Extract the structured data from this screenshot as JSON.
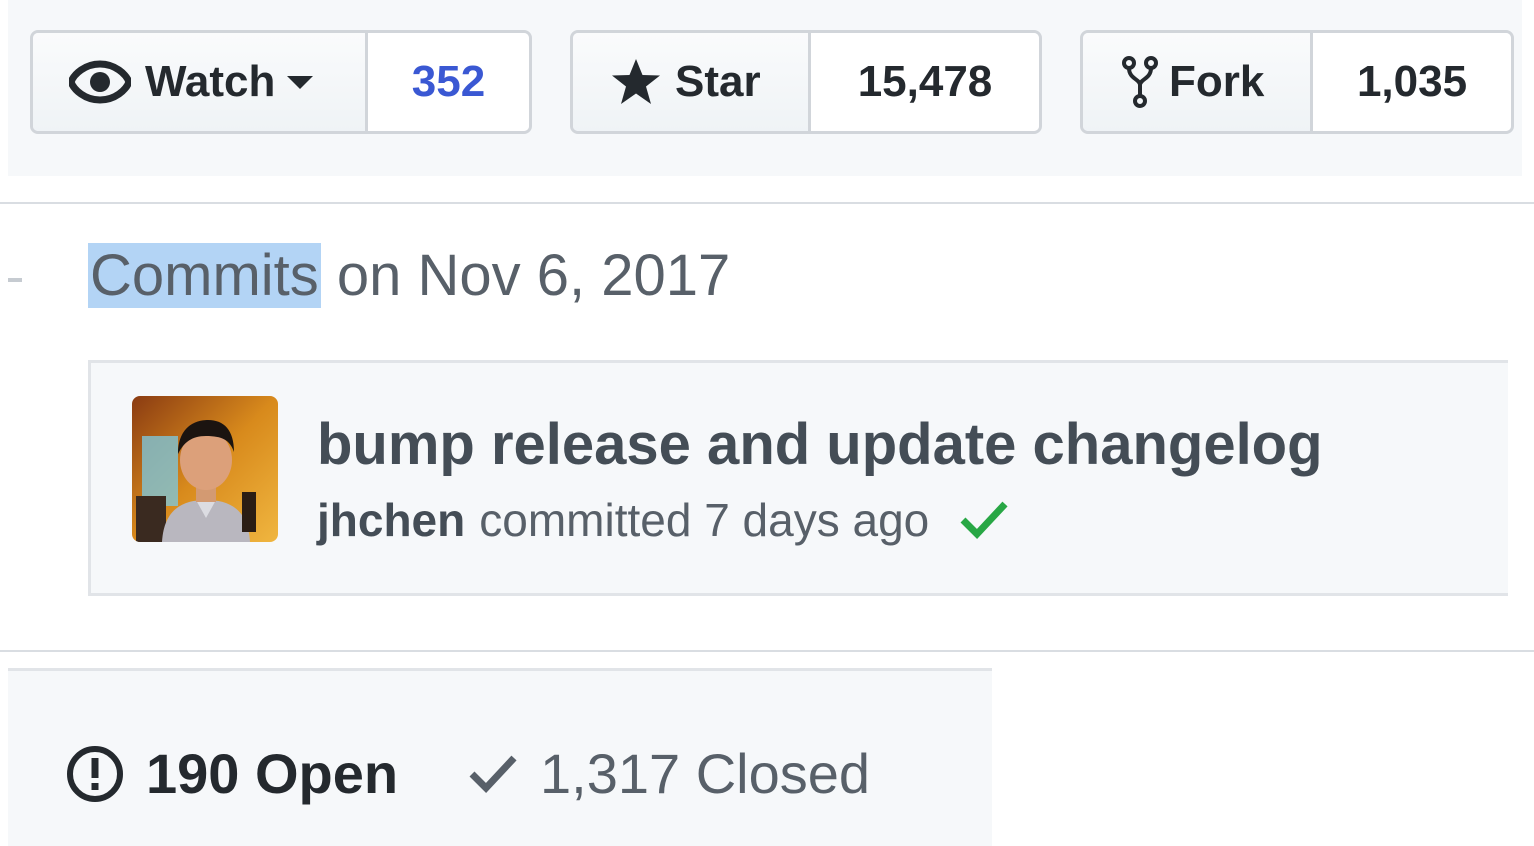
{
  "repo_actions": {
    "watch": {
      "label": "Watch",
      "count": "352",
      "icon": "eye-icon"
    },
    "star": {
      "label": "Star",
      "count": "15,478",
      "icon": "star-icon"
    },
    "fork": {
      "label": "Fork",
      "count": "1,035",
      "icon": "repo-forked-icon"
    }
  },
  "commits": {
    "heading_highlight": "Commits",
    "heading_rest": " on Nov 6, 2017",
    "commit": {
      "title": "bump release and update changelog",
      "author": "jhchen",
      "meta": "committed 7 days ago",
      "status_icon": "check-icon",
      "status_color": "#28a745"
    }
  },
  "issues": {
    "open_label": "190 Open",
    "closed_label": "1,317 Closed",
    "open_icon": "issue-opened-icon",
    "closed_icon": "check-icon"
  },
  "colors": {
    "count_link": "#3a58d3",
    "selection_highlight": "#b3d4f5",
    "panel_bg": "#f6f8fa"
  }
}
